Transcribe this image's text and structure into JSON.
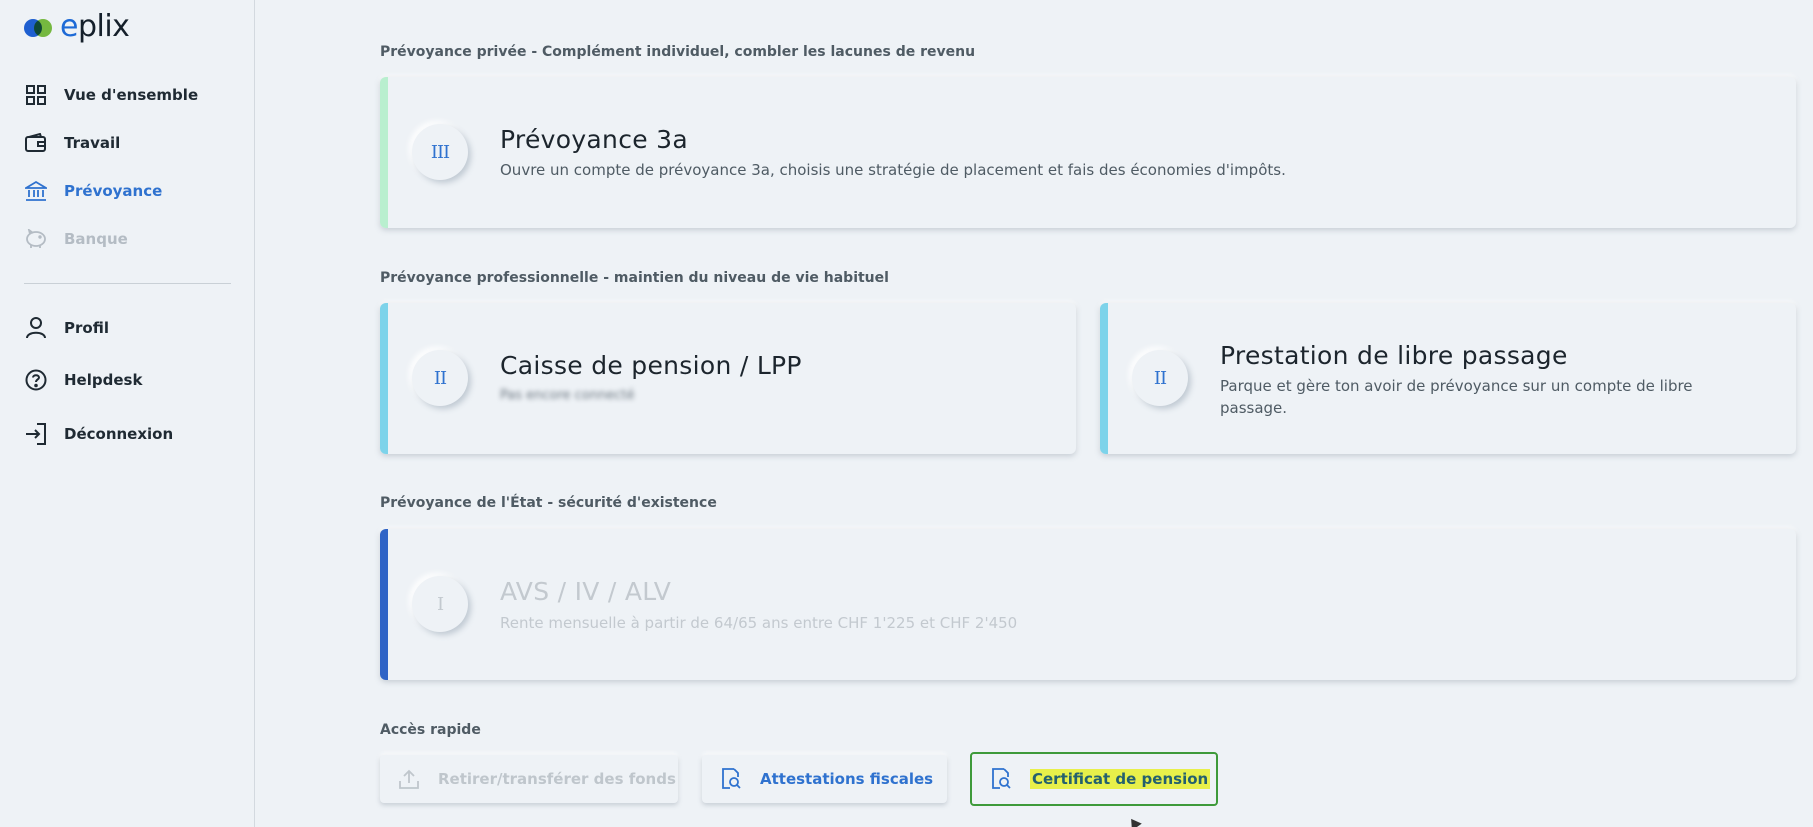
{
  "app": {
    "logo_text": "plix",
    "logo_e": "e"
  },
  "colors": {
    "accent": "#2f72cf",
    "mint": "#b9efcf",
    "sky": "#7dd3ea",
    "royal": "#2f64c6",
    "highlight": "#e8f04a",
    "selected_border": "#3e9a3a"
  },
  "sidebar": {
    "items": [
      {
        "label": "Vue d'ensemble",
        "icon": "grid-icon"
      },
      {
        "label": "Travail",
        "icon": "wallet-icon"
      },
      {
        "label": "Prévoyance",
        "icon": "bank-icon",
        "active": true
      },
      {
        "label": "Banque",
        "icon": "piggy-bank-icon",
        "disabled": true
      },
      {
        "label": "Profil",
        "icon": "user-icon"
      },
      {
        "label": "Helpdesk",
        "icon": "help-icon"
      },
      {
        "label": "Déconnexion",
        "icon": "logout-icon"
      }
    ]
  },
  "main": {
    "sections": {
      "private": "Prévoyance privée - Complément individuel, combler les lacunes de revenu",
      "professional": "Prévoyance professionnelle - maintien du niveau de vie habituel",
      "state": "Prévoyance de l'État - sécurité d'existence",
      "quick": "Accès rapide"
    },
    "cards": {
      "pillar3a": {
        "badge": "III",
        "title": "Prévoyance 3a",
        "desc": "Ouvre un compte de prévoyance 3a, choisis une stratégie de placement et fais des économies d'impôts."
      },
      "lpp": {
        "badge": "II",
        "title": "Caisse de pension / LPP",
        "desc": "Pas encore connecté"
      },
      "libre": {
        "badge": "II",
        "title": "Prestation de libre passage",
        "desc": "Parque et gère ton avoir de prévoyance sur un compte de libre passage."
      },
      "avs": {
        "badge": "I",
        "title": "AVS / IV / ALV",
        "desc": "Rente mensuelle à partir de 64/65 ans entre CHF 1'225 et CHF 2'450"
      }
    },
    "quick_access": [
      {
        "label": "Retirer/transférer des fonds",
        "icon": "upload-icon",
        "disabled": true
      },
      {
        "label": "Attestations fiscales",
        "icon": "document-search-icon"
      },
      {
        "label": "Certificat de pension",
        "icon": "document-search-icon",
        "selected": true
      }
    ]
  }
}
